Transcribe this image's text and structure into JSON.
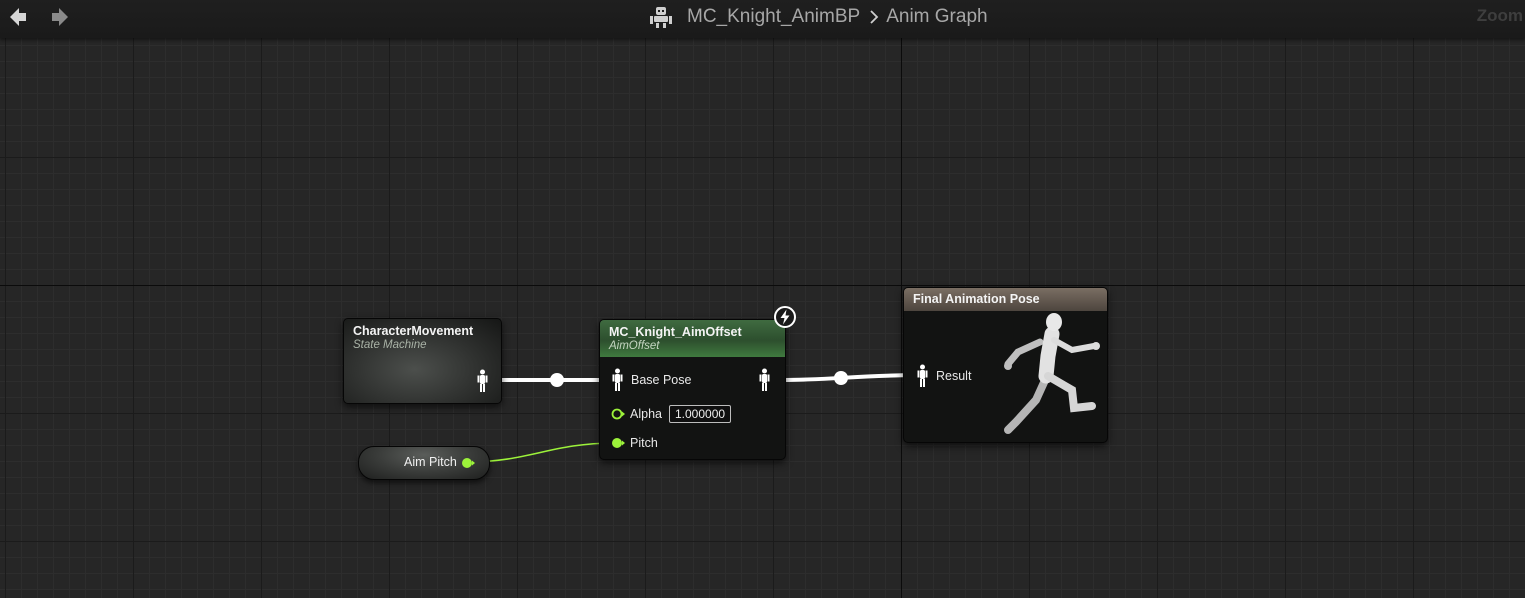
{
  "toolbar": {
    "back_icon": "arrow-left-icon",
    "forward_icon": "arrow-right-icon",
    "blueprint_icon": "anim-blueprint-icon",
    "breadcrumb": [
      "MC_Knight_AnimBP",
      "Anim Graph"
    ],
    "zoom_label": "Zoom"
  },
  "nodes": {
    "state_machine": {
      "title": "CharacterMovement",
      "subtitle": "State Machine",
      "output_icon": "pose-pin-icon"
    },
    "aim_offset": {
      "title": "MC_Knight_AimOffset",
      "subtitle": "AimOffset",
      "fast_path_icon": "lightning-icon",
      "pins": {
        "base_pose": "Base Pose",
        "alpha": "Alpha",
        "alpha_value": "1.000000",
        "pitch": "Pitch"
      }
    },
    "final_pose": {
      "title": "Final Animation Pose",
      "result_label": "Result",
      "preview_icon": "running-mannequin-icon"
    },
    "variable": {
      "label": "Aim Pitch"
    }
  },
  "colors": {
    "aim_offset_header": "#3f6b40",
    "final_pose_header": "#7a6e63",
    "float_pin": "#9cf23a",
    "pose_wire": "#ffffff"
  }
}
